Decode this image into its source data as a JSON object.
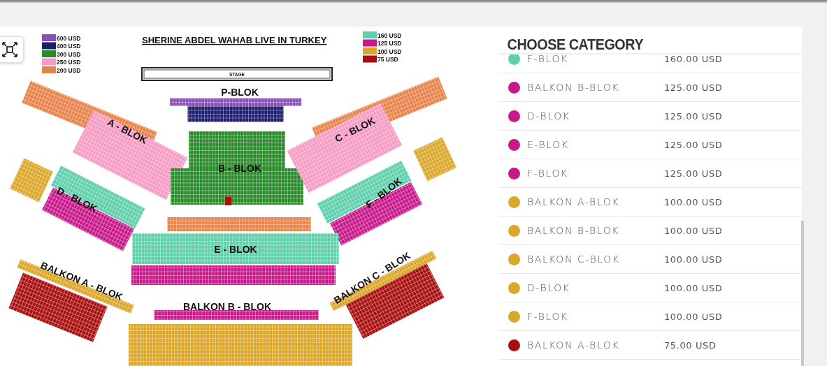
{
  "seat_map": {
    "title": "SHERINE ABDEL WAHAB LIVE IN TURKEY",
    "stage": "STAGE",
    "legend_left": [
      {
        "price": "600 USD",
        "color": "#8b4fb5"
      },
      {
        "price": "400 USD",
        "color": "#1d1d6e"
      },
      {
        "price": "300 USD",
        "color": "#2b8a2b"
      },
      {
        "price": "250 USD",
        "color": "#f69bc3"
      },
      {
        "price": "200 USD",
        "color": "#e8834c"
      }
    ],
    "legend_right": [
      {
        "price": "160 USD",
        "color": "#5fcfac"
      },
      {
        "price": "125 USD",
        "color": "#c8198a"
      },
      {
        "price": "100 USD",
        "color": "#dba72a"
      },
      {
        "price": "75 USD",
        "color": "#a81010"
      }
    ],
    "blocks": [
      {
        "label": "P-BLOK"
      },
      {
        "label": "A - BLOK"
      },
      {
        "label": "B - BLOK"
      },
      {
        "label": "C - BLOK"
      },
      {
        "label": "D - BLOK"
      },
      {
        "label": "F - BLOK"
      },
      {
        "label": "E - BLOK"
      },
      {
        "label": "BALKON  A - BLOK"
      },
      {
        "label": "BALKON  B - BLOK"
      },
      {
        "label": "BALKON  C - BLOK"
      }
    ]
  },
  "category_panel": {
    "title": "CHOOSE CATEGORY",
    "categories": [
      {
        "name": "F-BLOK",
        "price": "160.00 USD",
        "color": "#5fcfac"
      },
      {
        "name": "BALKON B-BLOK",
        "price": "125.00 USD",
        "color": "#c8198a"
      },
      {
        "name": "D-BLOK",
        "price": "125.00 USD",
        "color": "#c8198a"
      },
      {
        "name": "E-BLOK",
        "price": "125.00 USD",
        "color": "#c8198a"
      },
      {
        "name": "F-BLOK",
        "price": "125.00 USD",
        "color": "#c8198a"
      },
      {
        "name": "BALKON A-BLOK",
        "price": "100.00 USD",
        "color": "#dba72a"
      },
      {
        "name": "BALKON B-BLOK",
        "price": "100.00 USD",
        "color": "#dba72a"
      },
      {
        "name": "BALKON C-BLOK",
        "price": "100.00 USD",
        "color": "#dba72a"
      },
      {
        "name": "D-BLOK",
        "price": "100.00 USD",
        "color": "#dba72a"
      },
      {
        "name": "F-BLOK",
        "price": "100.00 USD",
        "color": "#dba72a"
      },
      {
        "name": "BALKON A-BLOK",
        "price": "75.00 USD",
        "color": "#a81010"
      }
    ]
  }
}
